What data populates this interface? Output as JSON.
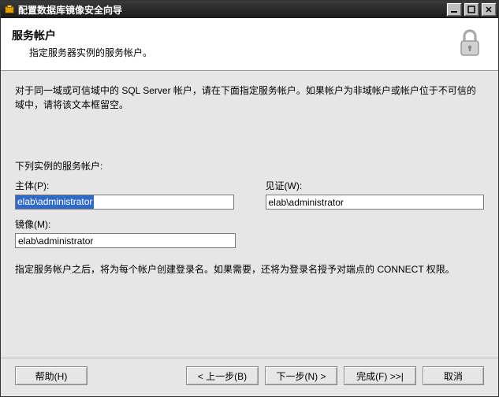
{
  "window": {
    "title": "配置数据库镜像安全向导"
  },
  "header": {
    "title": "服务帐户",
    "subtitle": "指定服务器实例的服务帐户。"
  },
  "body": {
    "intro": "对于同一域或可信域中的 SQL Server 帐户，请在下面指定服务帐户。如果帐户为非域帐户或帐户位于不可信的域中，请将该文本框留空。",
    "subheading": "下列实例的服务帐户:",
    "principal_label": "主体(P):",
    "principal_value": "elab\\administrator",
    "witness_label": "见证(W):",
    "witness_value": "elab\\administrator",
    "mirror_label": "镜像(M):",
    "mirror_value": "elab\\administrator",
    "note": "指定服务帐户之后，将为每个帐户创建登录名。如果需要，还将为登录名授予对端点的 CONNECT 权限。"
  },
  "footer": {
    "help": "帮助(H)",
    "back": "< 上一步(B)",
    "next": "下一步(N) >",
    "finish": "完成(F) >>|",
    "cancel": "取消"
  }
}
